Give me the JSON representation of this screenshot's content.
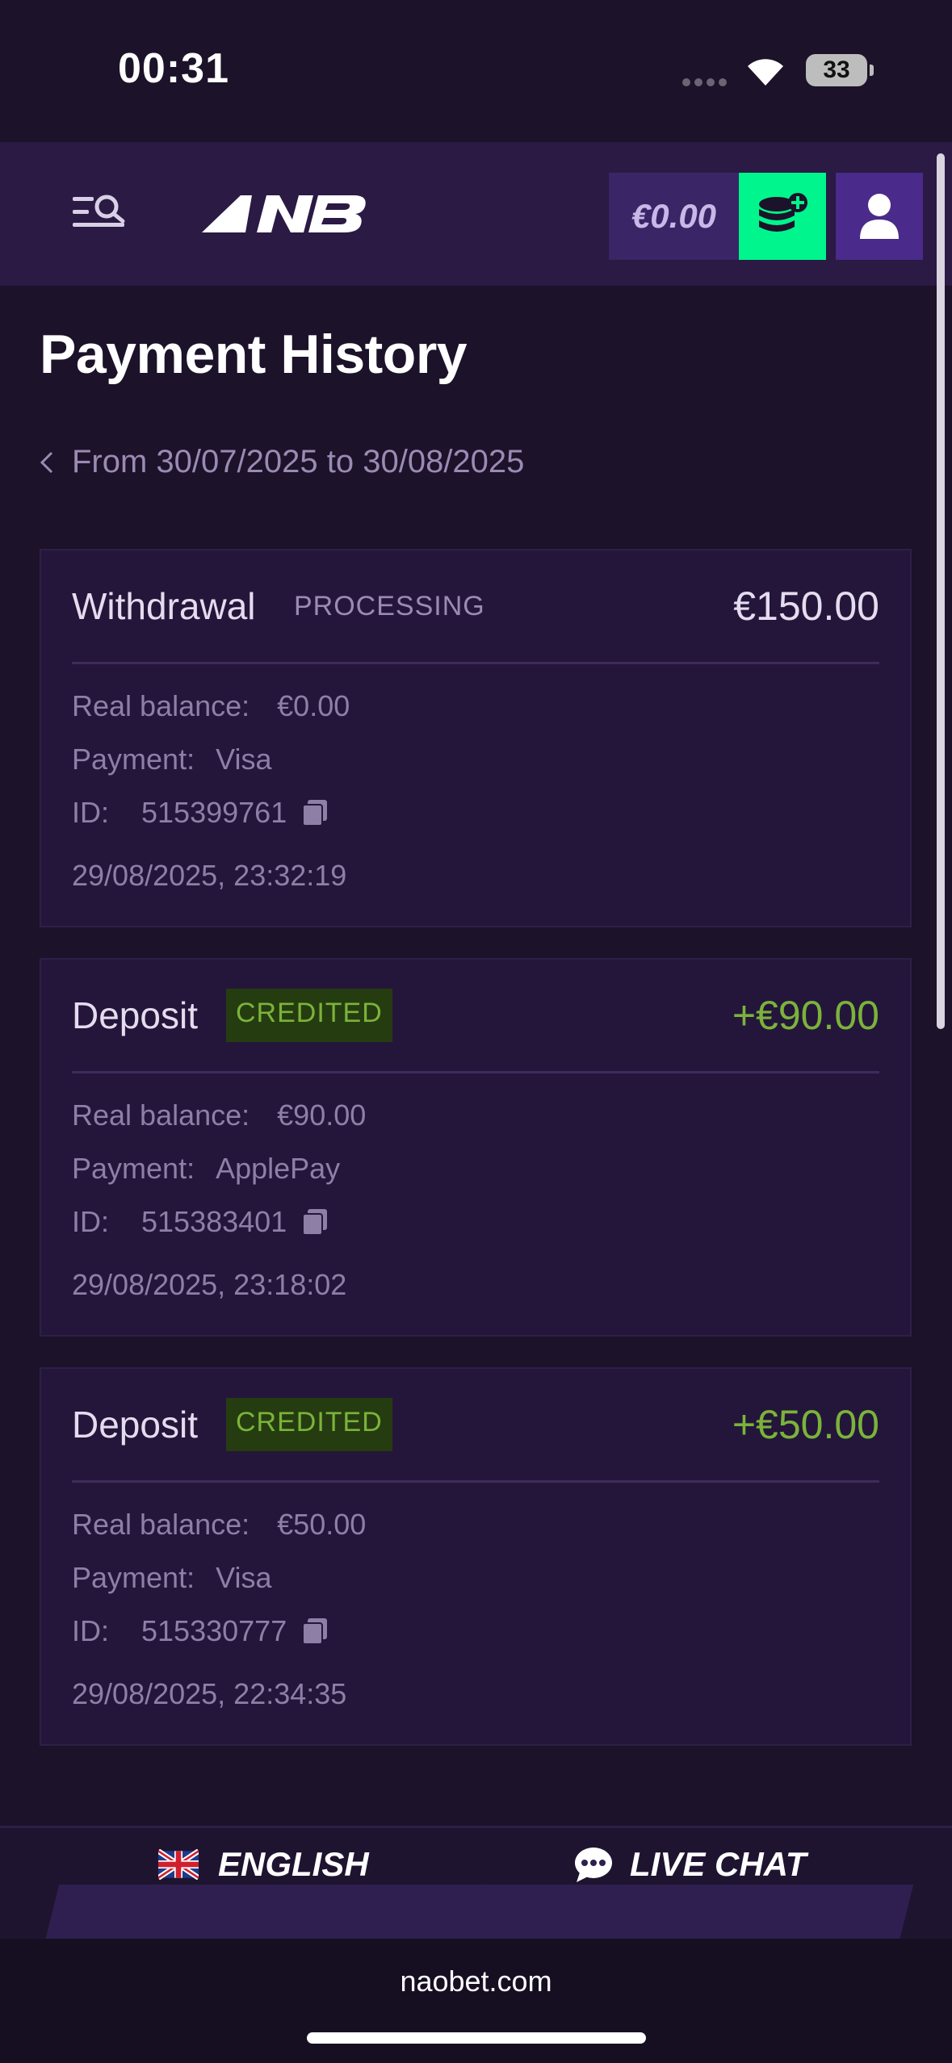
{
  "status_bar": {
    "time": "00:31",
    "battery": "33"
  },
  "header": {
    "balance": "€0.00"
  },
  "page": {
    "title": "Payment History",
    "date_range": "From 30/07/2025 to 30/08/2025"
  },
  "labels": {
    "real_balance": "Real balance:",
    "payment": "Payment:",
    "id": "ID:"
  },
  "transactions": [
    {
      "type": "Withdrawal",
      "status": "PROCESSING",
      "amount": "€150.00",
      "real_balance": "€0.00",
      "payment": "Visa",
      "id": "515399761",
      "datetime": "29/08/2025, 23:32:19"
    },
    {
      "type": "Deposit",
      "status": "CREDITED",
      "amount": "+€90.00",
      "real_balance": "€90.00",
      "payment": "ApplePay",
      "id": "515383401",
      "datetime": "29/08/2025, 23:18:02"
    },
    {
      "type": "Deposit",
      "status": "CREDITED",
      "amount": "+€50.00",
      "real_balance": "€50.00",
      "payment": "Visa",
      "id": "515330777",
      "datetime": "29/08/2025, 22:34:35"
    }
  ],
  "footer": {
    "language": "ENGLISH",
    "live_chat": "LIVE CHAT"
  },
  "browser": {
    "url": "naobet.com"
  },
  "colors": {
    "accent_green": "#00f58c",
    "credited": "#7bb33a",
    "background": "#1c1229",
    "card": "#24163a"
  }
}
